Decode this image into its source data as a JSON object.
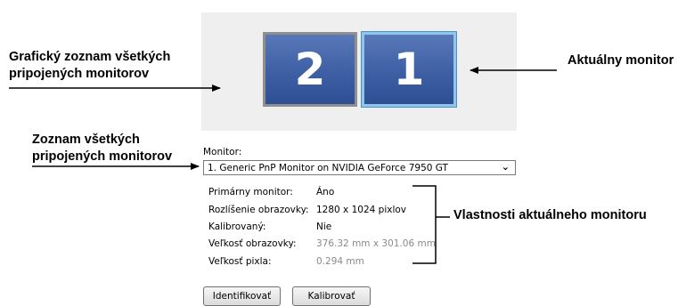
{
  "annotations": {
    "graphic_list": "Grafický zoznam všetkých pripojených monitorov",
    "current_monitor": "Aktuálny monitor",
    "list": "Zoznam všetkých pripojených monitorov",
    "properties": "Vlastnosti aktuálneho monitoru"
  },
  "monitors": [
    {
      "number": "2"
    },
    {
      "number": "1"
    }
  ],
  "monitor_label": "Monitor:",
  "monitor_select_value": "1. Generic PnP Monitor on NVIDIA GeForce 7950 GT",
  "properties": [
    {
      "label": "Primárny monitor:",
      "value": "Áno"
    },
    {
      "label": "Rozlíšenie obrazovky:",
      "value": "1280 x 1024 pixlov"
    },
    {
      "label": "Kalibrovaný:",
      "value": "Nie"
    },
    {
      "label": "Veľkosť obrazovky:",
      "value": "376.32 mm x 301.06 mm"
    },
    {
      "label": "Veľkosť pixla:",
      "value": "0.294 mm"
    }
  ],
  "buttons": {
    "identify": "Identifikovať",
    "calibrate": "Kalibrovať"
  }
}
